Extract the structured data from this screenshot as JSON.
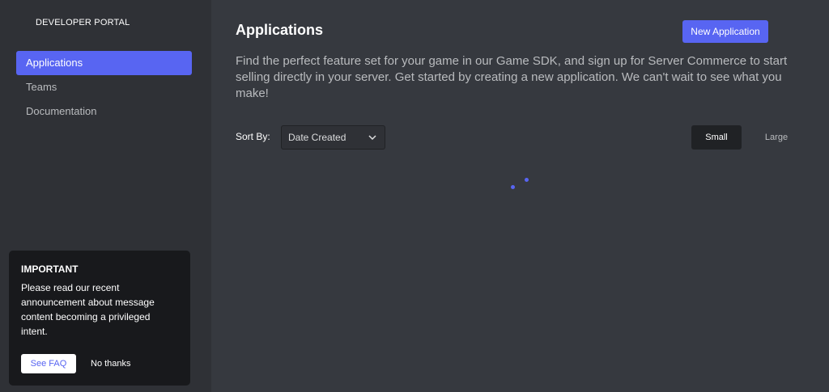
{
  "sidebar": {
    "brand": "DEVELOPER PORTAL",
    "items": [
      {
        "label": "Applications",
        "active": true
      },
      {
        "label": "Teams",
        "active": false
      },
      {
        "label": "Documentation",
        "active": false
      }
    ],
    "notice": {
      "title": "IMPORTANT",
      "body": "Please read our recent announcement about message content becoming a privileged intent.",
      "primary_label": "See FAQ",
      "secondary_label": "No thanks"
    }
  },
  "main": {
    "title": "Applications",
    "new_button_label": "New Application",
    "description": "Find the perfect feature set for your game in our Game SDK, and sign up for Server Commerce to start selling directly in your server. Get started by creating a new application. We can't wait to see what you make!",
    "sort": {
      "label": "Sort By:",
      "selected": "Date Created"
    },
    "size_toggle": {
      "options": [
        "Small",
        "Large"
      ],
      "selected": "Small"
    },
    "loading_icon": "loading-spinner-icon"
  },
  "colors": {
    "accent": "#5865f2",
    "sidebar_bg": "#2f3136",
    "main_bg": "#36393f",
    "card_bg": "#18191c"
  }
}
